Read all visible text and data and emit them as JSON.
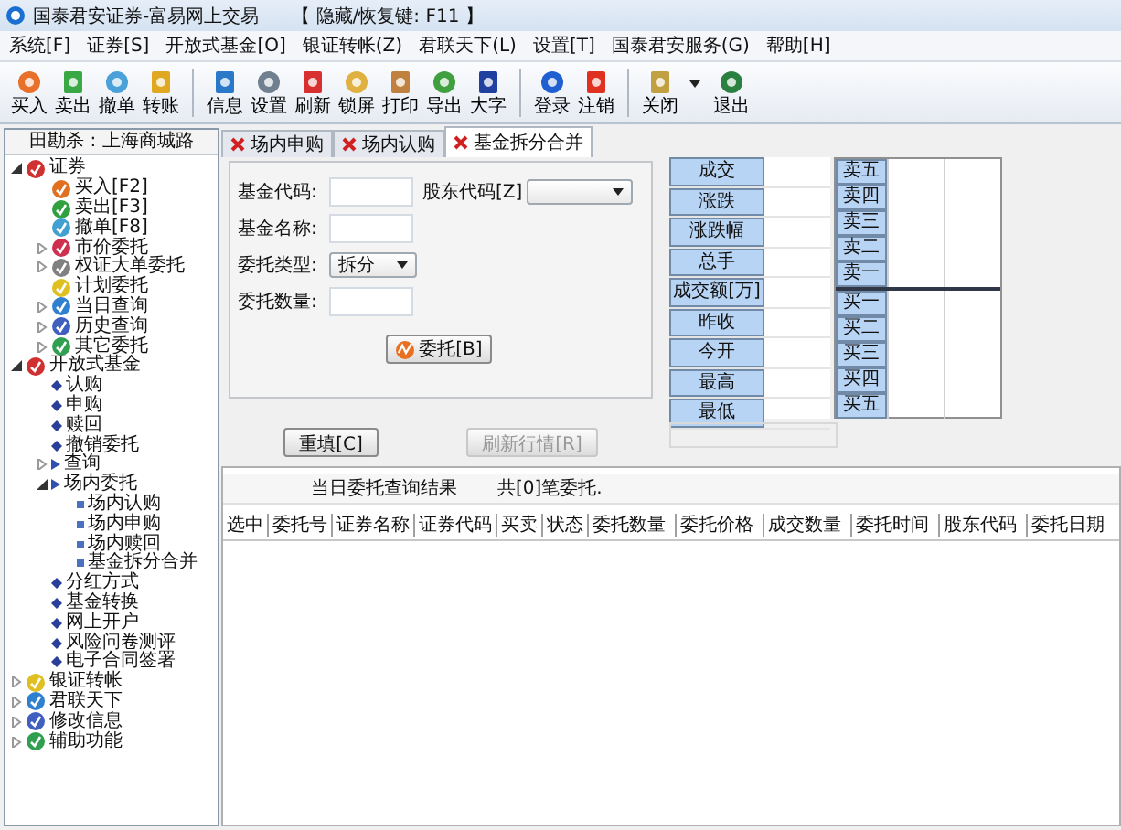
{
  "window": {
    "title": "国泰君安证券-富易网上交易",
    "hotkey_hint": "【 隐藏/恢复键: F11 】"
  },
  "menu": [
    "系统[F]",
    "证券[S]",
    "开放式基金[O]",
    "银证转帐(Z)",
    "君联天下(L)",
    "设置[T]",
    "国泰君安服务(G)",
    "帮助[H]"
  ],
  "toolbar": [
    [
      {
        "label": "买入"
      },
      {
        "label": "卖出"
      },
      {
        "label": "撤单"
      },
      {
        "label": "转账"
      }
    ],
    [
      {
        "label": "信息"
      },
      {
        "label": "设置"
      },
      {
        "label": "刷新"
      },
      {
        "label": "锁屏"
      },
      {
        "label": "打印"
      },
      {
        "label": "导出"
      },
      {
        "label": "大字"
      }
    ],
    [
      {
        "label": "登录"
      },
      {
        "label": "注销"
      }
    ],
    [
      {
        "label": "关闭",
        "has_menu": true
      },
      {
        "label": "退出",
        "has_menu": false
      }
    ]
  ],
  "sidebar": {
    "branch": "田勘杀 : 上海商城路",
    "tree": [
      {
        "label": "证券",
        "kind": "icon",
        "expanded": true,
        "children": [
          {
            "label": "买入[F2]",
            "kind": "icon"
          },
          {
            "label": "卖出[F3]",
            "kind": "icon"
          },
          {
            "label": "撤单[F8]",
            "kind": "icon"
          },
          {
            "label": "市价委托",
            "kind": "icon",
            "expanded": false
          },
          {
            "label": "权证大单委托",
            "kind": "icon",
            "expanded": false
          },
          {
            "label": "计划委托",
            "kind": "icon"
          },
          {
            "label": "当日查询",
            "kind": "icon",
            "expanded": false
          },
          {
            "label": "历史查询",
            "kind": "icon",
            "expanded": false
          },
          {
            "label": "其它委托",
            "kind": "icon",
            "expanded": false
          }
        ]
      },
      {
        "label": "开放式基金",
        "kind": "icon",
        "expanded": true,
        "children": [
          {
            "label": "认购",
            "kind": "diamond"
          },
          {
            "label": "申购",
            "kind": "diamond"
          },
          {
            "label": "赎回",
            "kind": "diamond"
          },
          {
            "label": "撤销委托",
            "kind": "diamond"
          },
          {
            "label": "查询",
            "kind": "arrow",
            "expanded": false
          },
          {
            "label": "场内委托",
            "kind": "arrow",
            "expanded": true,
            "children": [
              {
                "label": "场内认购",
                "kind": "square"
              },
              {
                "label": "场内申购",
                "kind": "square"
              },
              {
                "label": "场内赎回",
                "kind": "square"
              },
              {
                "label": "基金拆分合并",
                "kind": "square"
              }
            ]
          },
          {
            "label": "分红方式",
            "kind": "diamond"
          },
          {
            "label": "基金转换",
            "kind": "diamond"
          },
          {
            "label": "网上开户",
            "kind": "diamond"
          },
          {
            "label": "风险问卷测评",
            "kind": "diamond"
          },
          {
            "label": "电子合同签署",
            "kind": "diamond"
          }
        ]
      },
      {
        "label": "银证转帐",
        "kind": "icon",
        "expanded": false
      },
      {
        "label": "君联天下",
        "kind": "icon",
        "expanded": false
      },
      {
        "label": "修改信息",
        "kind": "icon",
        "expanded": false
      },
      {
        "label": "辅助功能",
        "kind": "icon",
        "expanded": false
      }
    ]
  },
  "tabs": [
    {
      "label": "场内申购",
      "selected": false
    },
    {
      "label": "场内认购",
      "selected": false
    },
    {
      "label": "基金拆分合并",
      "selected": true
    }
  ],
  "form": {
    "fund_code_label": "基金代码:",
    "holder_code_label": "股东代码[Z]",
    "fund_name_label": "基金名称:",
    "order_type_label": "委托类型:",
    "order_type_value": "拆分",
    "quantity_label": "委托数量:",
    "submit_button": "委托[B]",
    "reset_button": "重填[C]",
    "refresh_button": {
      "label": "刷新行情[R]",
      "disabled": true
    }
  },
  "quote": {
    "fields": [
      "成交",
      "涨跌",
      "涨跌幅",
      "总手",
      "成交额[万]",
      "昨收",
      "今开",
      "最高",
      "最低"
    ],
    "sell": [
      "卖五",
      "卖四",
      "卖三",
      "卖二",
      "卖一"
    ],
    "buy": [
      "买一",
      "买二",
      "买三",
      "买四",
      "买五"
    ]
  },
  "results": {
    "title": "当日委托查询结果",
    "count": "共[0]笔委托.",
    "columns": [
      "选中",
      "委托号",
      "证券名称",
      "证券代码",
      "买卖",
      "状态",
      "委托数量",
      "委托价格",
      "成交数量",
      "委托时间",
      "股东代码",
      "委托日期"
    ]
  }
}
